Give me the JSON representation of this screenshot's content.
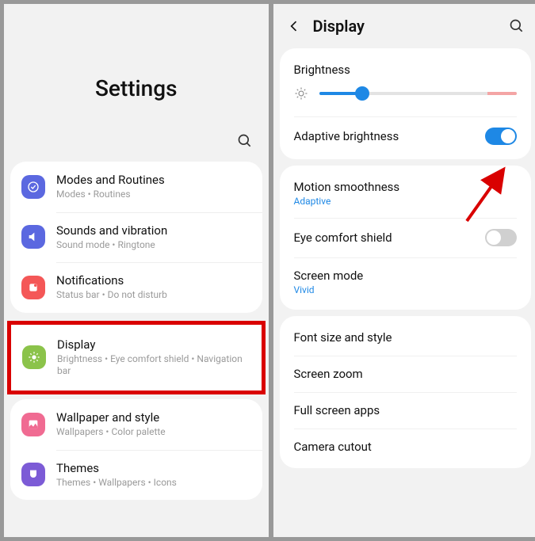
{
  "left": {
    "title": "Settings",
    "items": [
      {
        "label": "Modes and Routines",
        "sub": "Modes • Routines"
      },
      {
        "label": "Sounds and vibration",
        "sub": "Sound mode • Ringtone"
      },
      {
        "label": "Notifications",
        "sub": "Status bar • Do not disturb"
      },
      {
        "label": "Display",
        "sub": "Brightness • Eye comfort shield • Navigation bar"
      },
      {
        "label": "Wallpaper and style",
        "sub": "Wallpapers • Color palette"
      },
      {
        "label": "Themes",
        "sub": "Themes • Wallpapers • Icons"
      }
    ]
  },
  "right": {
    "title": "Display",
    "brightness_label": "Brightness",
    "brightness_pct": 22,
    "adaptive_label": "Adaptive brightness",
    "adaptive_on": true,
    "motion_label": "Motion smoothness",
    "motion_value": "Adaptive",
    "eye_label": "Eye comfort shield",
    "eye_on": false,
    "screenmode_label": "Screen mode",
    "screenmode_value": "Vivid",
    "font_label": "Font size and style",
    "zoom_label": "Screen zoom",
    "fullscreen_label": "Full screen apps",
    "cutout_label": "Camera cutout"
  }
}
